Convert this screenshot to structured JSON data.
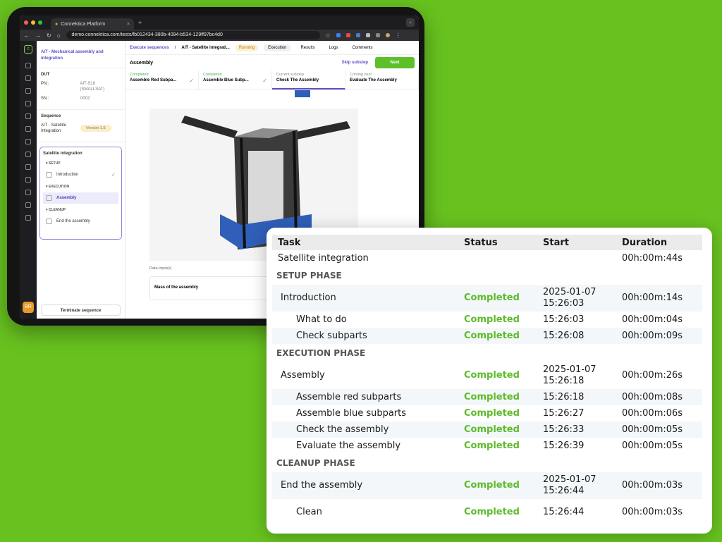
{
  "browser": {
    "tab_title": "Connektica Platform",
    "url": "demo.connektica.com/tests/fb012434-380b-4094-b534-129ff97bc4d0"
  },
  "rail": {
    "avatar": "BR"
  },
  "sidebar": {
    "title": "AIT - Mechanical assembly and integration",
    "dut_heading": "DUT",
    "pn_label": "PN :",
    "pn_value": "AIT-S10 (SMALLSAT)",
    "sn_label": "SN :",
    "sn_value": "0002",
    "sequence_heading": "Sequence",
    "sequence_name": "AIT - Satellite Integration",
    "version": "Version 1.5",
    "steps_title": "Satellite integration",
    "groups": [
      {
        "label": "SETUP",
        "item": "Introduction"
      },
      {
        "label": "EXECUTION",
        "item": "Assembly"
      },
      {
        "label": "CLEANUP",
        "item": "End the assembly"
      }
    ],
    "terminate": "Terminate sequence"
  },
  "topnav": {
    "breadcrumb_root": "Execute sequences",
    "breadcrumb_current": "AIT - Satellite integrati...",
    "status": "Running",
    "tabs": [
      "Execution",
      "Results",
      "Logs",
      "Comments"
    ]
  },
  "step": {
    "title": "Assembly",
    "skip": "Skip substep",
    "next": "Next",
    "substeps": [
      {
        "state": "Completed",
        "name": "Assemble Red Subpa..."
      },
      {
        "state": "Completed",
        "name": "Assemble Blue Subp..."
      },
      {
        "state": "Current substep",
        "name": "Check The Assembly"
      },
      {
        "state": "Coming next",
        "name": "Evaluate The Assembly"
      }
    ],
    "data_inputs_label": "Data input(s)",
    "input_name": "Mass of the assembly"
  },
  "table": {
    "headers": [
      "Task",
      "Status",
      "Start",
      "Duration"
    ],
    "root": {
      "task": "Satellite integration",
      "duration": "00h:00m:44s"
    },
    "phases": [
      {
        "name": "SETUP PHASE",
        "step": {
          "task": "Introduction",
          "status": "Completed",
          "start_date": "2025-01-07",
          "start_time": "15:26:03",
          "duration": "00h:00m:14s"
        },
        "subs": [
          {
            "task": "What to do",
            "status": "Completed",
            "start": "15:26:03",
            "duration": "00h:00m:04s"
          },
          {
            "task": "Check subparts",
            "status": "Completed",
            "start": "15:26:08",
            "duration": "00h:00m:09s"
          }
        ]
      },
      {
        "name": "EXECUTION PHASE",
        "step": {
          "task": "Assembly",
          "status": "Completed",
          "start_date": "2025-01-07",
          "start_time": "15:26:18",
          "duration": "00h:00m:26s"
        },
        "subs": [
          {
            "task": "Assemble red subparts",
            "status": "Completed",
            "start": "15:26:18",
            "duration": "00h:00m:08s"
          },
          {
            "task": "Assemble blue subparts",
            "status": "Completed",
            "start": "15:26:27",
            "duration": "00h:00m:06s"
          },
          {
            "task": "Check the assembly",
            "status": "Completed",
            "start": "15:26:33",
            "duration": "00h:00m:05s"
          },
          {
            "task": "Evaluate the assembly",
            "status": "Completed",
            "start": "15:26:39",
            "duration": "00h:00m:05s"
          }
        ]
      },
      {
        "name": "CLEANUP PHASE",
        "step": {
          "task": "End the assembly",
          "status": "Completed",
          "start_date": "2025-01-07",
          "start_time": "15:26:44",
          "duration": "00h:00m:03s"
        },
        "subs": [
          {
            "task": "Clean",
            "status": "Completed",
            "start": "15:26:44",
            "duration": "00h:00m:03s"
          }
        ]
      }
    ]
  }
}
